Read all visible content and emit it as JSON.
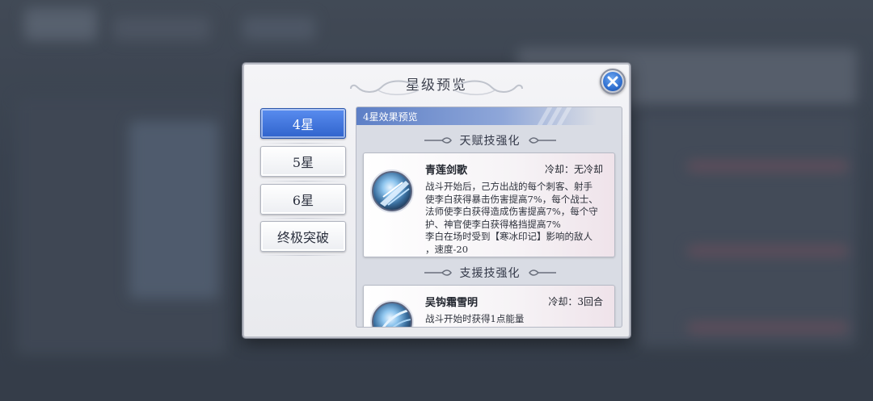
{
  "dialog": {
    "title": "星级预览"
  },
  "tabs": [
    {
      "label": "4星",
      "active": true
    },
    {
      "label": "5星",
      "active": false
    },
    {
      "label": "6星",
      "active": false
    },
    {
      "label": "终极突破",
      "active": false
    }
  ],
  "panel": {
    "header": "4星效果预览",
    "sections": [
      {
        "title": "天赋技强化",
        "skill": {
          "name": "青莲剑歌",
          "cooldown": "冷却：无冷却",
          "description": [
            "战斗开始后，己方出战的每个刺客、射手",
            "使李白获得暴击伤害提高7%，每个战士、",
            "法师使李白获得造成伤害提高7%，每个守",
            "护、神官使李白获得格挡提高7%",
            "李白在场时受到【寒冰印记】影响的敌人",
            "，速度-20"
          ]
        }
      },
      {
        "title": "支援技强化",
        "skill": {
          "name": "吴钩霜雪明",
          "cooldown": "冷却：3回合",
          "description": [
            "战斗开始时获得1点能量"
          ]
        }
      }
    ]
  },
  "colors": {
    "active_tab": "#2f63cc",
    "panel_header": "#5d7fc6",
    "close_button": "#2f6fd0"
  }
}
